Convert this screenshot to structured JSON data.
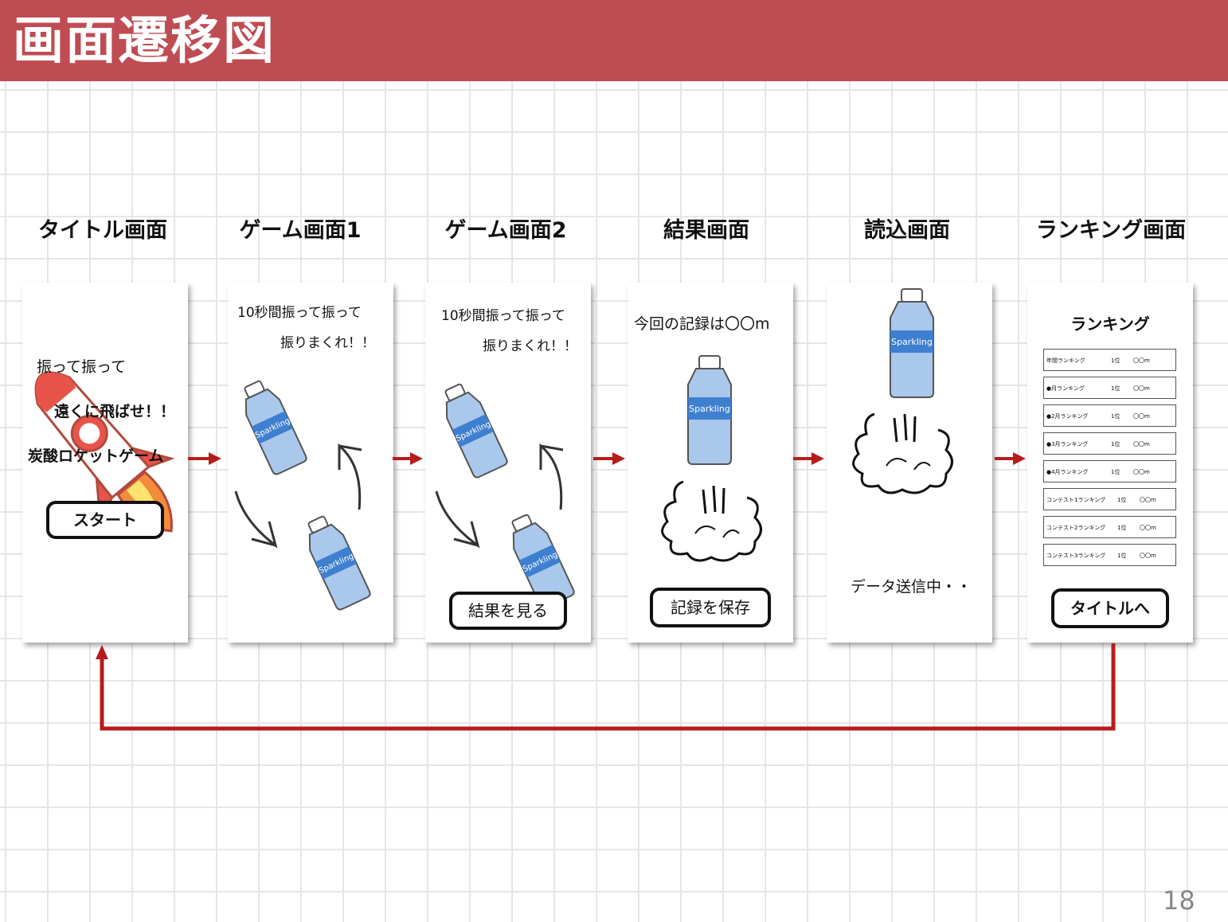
{
  "slide": {
    "title": "画面遷移図",
    "page_number": "18",
    "accent_color": "#bf4c52",
    "arrow_color": "#b71c1c"
  },
  "stages": [
    {
      "title": "タイトル画面"
    },
    {
      "title": "ゲーム画面1"
    },
    {
      "title": "ゲーム画面2"
    },
    {
      "title": "結果画面"
    },
    {
      "title": "読込画面"
    },
    {
      "title": "ランキング画面"
    }
  ],
  "title_screen": {
    "line1": "振って振って",
    "line2": "遠くに飛ばせ！！",
    "line3": "炭酸ロケットゲーム",
    "start_button": "スタート"
  },
  "game1": {
    "line1": "10秒間振って振って",
    "line2": "振りまくれ！！",
    "bottle_label": "Sparkling"
  },
  "game2": {
    "line1": "10秒間振って振って",
    "line2": "振りまくれ！！",
    "bottle_label": "Sparkling",
    "result_button": "結果を見る"
  },
  "result": {
    "record_text": "今回の記録は〇〇m",
    "bottle_label": "Sparkling",
    "save_button": "記録を保存"
  },
  "loading": {
    "bottle_label": "Sparkling",
    "status_text": "データ送信中・・"
  },
  "ranking": {
    "heading": "ランキング",
    "rows": [
      {
        "name": "年間ランキング",
        "rank": "1位",
        "value": "〇〇m"
      },
      {
        "name": "●月ランキング",
        "rank": "1位",
        "value": "〇〇m"
      },
      {
        "name": "●2月ランキング",
        "rank": "1位",
        "value": "〇〇m"
      },
      {
        "name": "●3月ランキング",
        "rank": "1位",
        "value": "〇〇m"
      },
      {
        "name": "●4月ランキング",
        "rank": "1位",
        "value": "〇〇m"
      },
      {
        "name": "コンテスト1ランキング",
        "rank": "1位",
        "value": "〇〇m"
      },
      {
        "name": "コンテスト2ランキング",
        "rank": "1位",
        "value": "〇〇m"
      },
      {
        "name": "コンテスト3ランキング",
        "rank": "1位",
        "value": "〇〇m"
      }
    ],
    "title_button": "タイトルへ"
  }
}
